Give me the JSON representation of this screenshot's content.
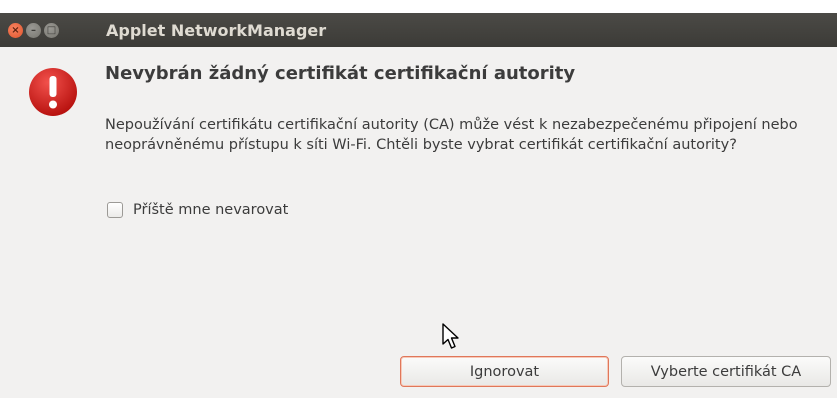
{
  "window": {
    "title": "Applet NetworkManager",
    "close_glyph": "×",
    "minimize_glyph": "–",
    "maximize_glyph": "□"
  },
  "dialog": {
    "icon": "dialog-warning-icon",
    "heading": "Nevybrán žádný certifikát certifikační autority",
    "message": "Nepoužívání certifikátu certifikační autority (CA) může vést k nezabezpečenému připojení nebo neoprávněnému přístupu k síti Wi-Fi. Chtěli byste vybrat certifikát certifikační autority?",
    "checkbox": {
      "label": "Příště mne nevarovat",
      "checked": false
    },
    "buttons": {
      "ignore": "Ignorovat",
      "choose": "Vyberte certifikát CA"
    }
  },
  "colors": {
    "titlebar": "#3c3b37",
    "close_button": "#e0562e",
    "dialog_bg": "#f2f1f0",
    "warning_icon": "#d3211d",
    "focus_border": "#e0775a"
  }
}
